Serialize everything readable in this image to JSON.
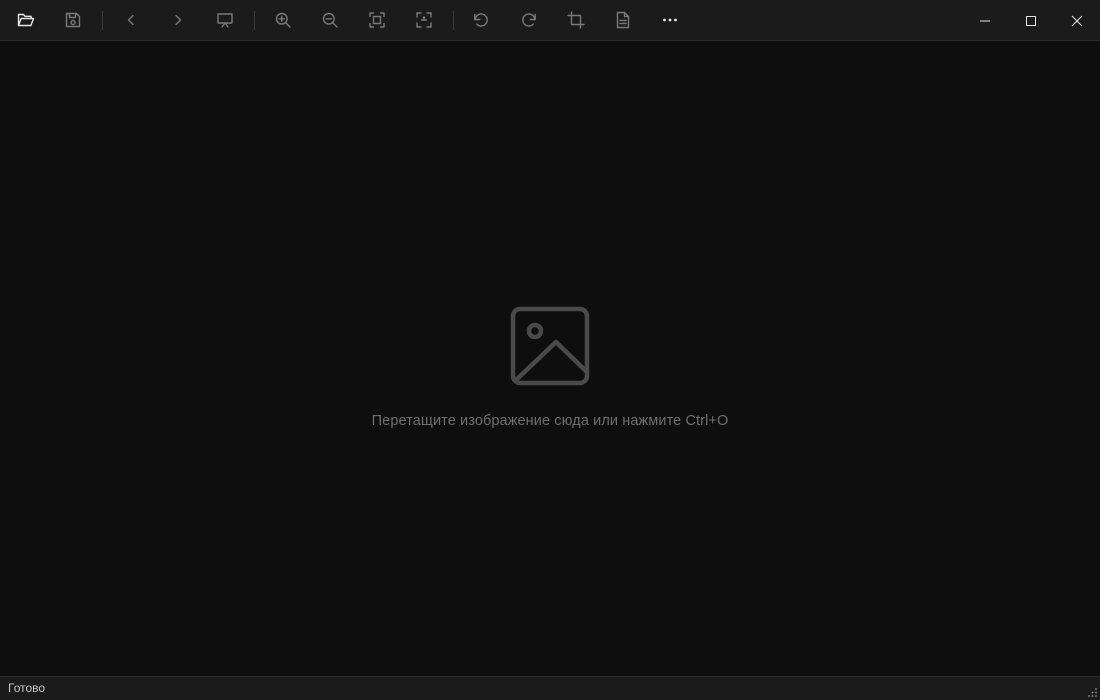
{
  "toolbar": {
    "buttons": [
      {
        "name": "open-folder-icon",
        "enabled": true
      },
      {
        "name": "save-icon",
        "enabled": false
      },
      {
        "name": "previous-icon",
        "enabled": false
      },
      {
        "name": "next-icon",
        "enabled": false
      },
      {
        "name": "slideshow-icon",
        "enabled": false
      },
      {
        "name": "zoom-in-icon",
        "enabled": false
      },
      {
        "name": "zoom-out-icon",
        "enabled": false
      },
      {
        "name": "fit-to-window-icon",
        "enabled": false
      },
      {
        "name": "actual-size-icon",
        "enabled": false
      },
      {
        "name": "rotate-left-icon",
        "enabled": false
      },
      {
        "name": "rotate-right-icon",
        "enabled": false
      },
      {
        "name": "crop-icon",
        "enabled": false
      },
      {
        "name": "file-info-icon",
        "enabled": false
      },
      {
        "name": "more-options-icon",
        "enabled": true
      }
    ]
  },
  "window_controls": [
    "minimize-icon",
    "maximize-icon",
    "close-icon"
  ],
  "canvas": {
    "placeholder_icon": "image-placeholder-icon",
    "hint": "Перетащите изображение сюда или нажмите Ctrl+O"
  },
  "status": {
    "text": "Готово"
  },
  "colors": {
    "toolbar_bg": "#1b1b1b",
    "canvas_bg": "#0e0e0e",
    "icon_enabled": "#e6e6e6",
    "icon_disabled": "#7a7a7a",
    "placeholder": "#4a4a4a",
    "hint_text": "#6f6f6f"
  }
}
